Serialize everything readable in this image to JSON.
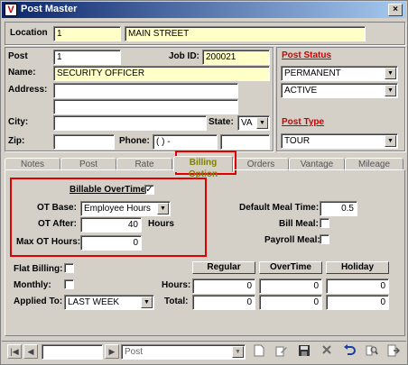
{
  "window": {
    "title": "Post Master",
    "app_icon": "V",
    "close_glyph": "×"
  },
  "location": {
    "label": "Location",
    "code": "1",
    "name": "MAIN STREET"
  },
  "post": {
    "post_label": "Post",
    "post_value": "1",
    "job_id_label": "Job ID:",
    "job_id_value": "200021",
    "name_label": "Name:",
    "name_value": "SECURITY OFFICER",
    "address_label": "Address:",
    "address_line1": "",
    "address_line2": "",
    "city_label": "City:",
    "city_value": "",
    "state_label": "State:",
    "state_value": "VA",
    "zip_label": "Zip:",
    "zip_value": "",
    "phone_label": "Phone:",
    "phone_value": "(   )    -",
    "phone_ext": ""
  },
  "status": {
    "post_status_label": "Post Status",
    "status_select1": "PERMANENT",
    "status_select2": "ACTIVE",
    "post_type_label": "Post Type",
    "post_type_select": "TOUR"
  },
  "tabs": [
    {
      "label": "Notes"
    },
    {
      "label": "Post"
    },
    {
      "label": "Rate"
    },
    {
      "label": "Billing Option"
    },
    {
      "label": "Orders"
    },
    {
      "label": "Vantage"
    },
    {
      "label": "Mileage"
    }
  ],
  "billing": {
    "billable_overtime_label": "Billable OverTime",
    "billable_overtime_checked": "✓",
    "ot_base_label": "OT Base:",
    "ot_base_value": "Employee Hours",
    "ot_after_label": "OT After:",
    "ot_after_value": "40",
    "hours_suffix": "Hours",
    "max_ot_label": "Max OT Hours:",
    "max_ot_value": "0",
    "default_meal_label": "Default Meal Time:",
    "default_meal_value": "0.5",
    "bill_meal_label": "Bill Meal:",
    "payroll_meal_label": "Payroll Meal:",
    "flat_billing_label": "Flat Billing:",
    "monthly_label": "Monthly:",
    "applied_to_label": "Applied To:",
    "applied_to_value": "LAST WEEK",
    "hours_label": "Hours:",
    "total_label": "Total:",
    "col_regular": "Regular",
    "col_overtime": "OverTime",
    "col_holiday": "Holiday",
    "hours_regular": "0",
    "hours_overtime": "0",
    "hours_holiday": "0",
    "total_regular": "0",
    "total_overtime": "0",
    "total_holiday": "0"
  },
  "navbar": {
    "record_value": "",
    "lookup_value": "Post",
    "first_glyph": "|◀",
    "prev_glyph": "◀",
    "next_glyph": "▶",
    "last_glyph": "▶|"
  },
  "colors": {
    "required_label": "#cc0000",
    "highlight": "#e00000",
    "active_tab": "#808000",
    "title_bar": "#0a246a"
  }
}
